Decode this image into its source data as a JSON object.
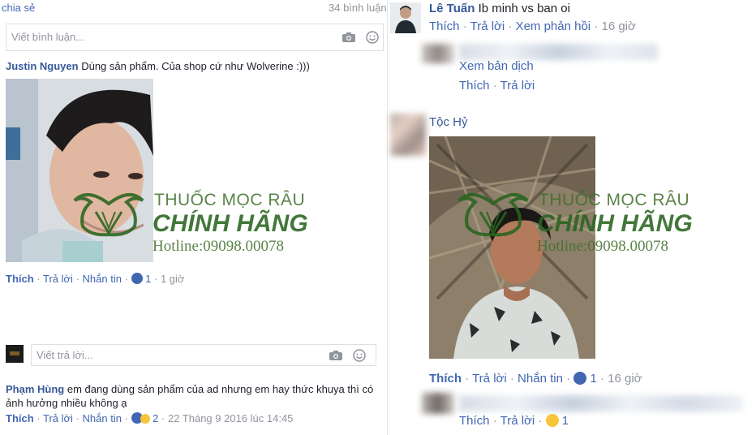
{
  "left": {
    "share_label": "chia sẻ",
    "comment_count": "34 bình luận",
    "comment_placeholder": "Viết bình luận...",
    "c1": {
      "author": "Justin Nguyen",
      "text": "Dùng sản phẩm. Của shop cứ như Wolverine :)))",
      "like": "Thích",
      "reply": "Trả lời",
      "message": "Nhắn tin",
      "reactions": "1",
      "time": "1 giờ"
    },
    "reply_placeholder": "Viết trả lời...",
    "c2": {
      "author": "Phạm Hùng",
      "text_line1": "em đang dùng sản phẩm của ad nhưng em hay thức khuya thì có",
      "text_line2": "ảnh hưởng nhiều không ạ",
      "like": "Thích",
      "reply": "Trả lời",
      "message": "Nhắn tin",
      "reactions": "2",
      "time": "22 Tháng 9 2016 lúc 14:45"
    }
  },
  "watermark": {
    "line1": "THUỐC MỌC RÂU",
    "line2": "CHÍNH HÃNG",
    "line3": "Hotline:09098.00078"
  },
  "right": {
    "c1": {
      "author": "Lê Tuấn",
      "text": "Ib minh vs ban oi",
      "like": "Thích",
      "reply": "Trả lời",
      "see_replies": "Xem phản hồi",
      "time": "16 giờ"
    },
    "r1": {
      "translate": "Xem bản dịch",
      "like": "Thích",
      "reply": "Trả lời"
    },
    "c2": {
      "author": "Tộc Hỷ",
      "like": "Thích",
      "reply": "Trả lời",
      "message": "Nhắn tin",
      "reactions": "1",
      "time": "16 giờ"
    },
    "r2": {
      "like": "Thích",
      "reply": "Trả lời",
      "reactions": "1"
    }
  },
  "colors": {
    "link": "#4267b2",
    "name": "#365899",
    "muted": "#90949c",
    "watermark": "#2f6a22"
  }
}
